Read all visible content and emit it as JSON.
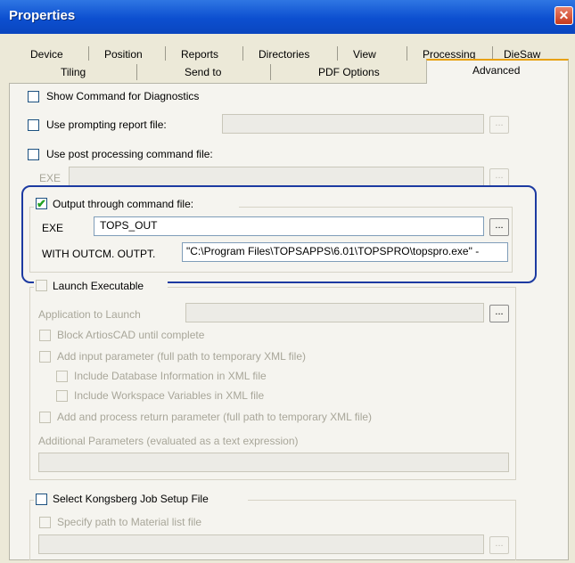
{
  "window": {
    "title": "Properties",
    "close_symbol": "✕"
  },
  "tabs": {
    "row1": [
      "Device",
      "Position",
      "Reports",
      "Directories",
      "View",
      "Processing",
      "DieSaw"
    ],
    "row2": [
      "Tiling",
      "Send to",
      "PDF Options",
      "Advanced"
    ],
    "active": "Advanced"
  },
  "options": {
    "show_command": {
      "label": "Show Command for Diagnostics",
      "checked": false
    },
    "prompting_report": {
      "label": "Use prompting report file:",
      "checked": false,
      "value": "",
      "browse": "..."
    },
    "post_processing": {
      "label": "Use post processing command file:",
      "checked": false,
      "exe_label": "EXE",
      "exe_value": "",
      "browse": "..."
    }
  },
  "output_command": {
    "label": "Output through command file:",
    "checked": true,
    "exe_label": "EXE",
    "exe_value": "TOPS_OUT",
    "browse": "...",
    "with_label": "WITH OUTCM. OUTPT.",
    "with_value": "\"C:\\Program Files\\TOPSAPPS\\6.01\\TOPSPRO\\topspro.exe\" -"
  },
  "launch_executable": {
    "label": "Launch Executable",
    "app_label": "Application to Launch",
    "app_value": "",
    "browse": "...",
    "block_label": "Block ArtiosCAD until complete",
    "add_input_label": "Add input parameter (full path to temporary XML file)",
    "include_db_label": "Include Database Information in XML file",
    "include_ws_label": "Include Workspace Variables in XML file",
    "add_return_label": "Add and process return parameter (full path to temporary XML file)",
    "additional_label": "Additional Parameters (evaluated as a text expression)",
    "additional_value": ""
  },
  "kongsberg": {
    "label": "Select Kongsberg Job Setup File",
    "material_label": "Specify path to Material list file",
    "material_value": "",
    "browse": "..."
  },
  "colors": {
    "titlebar": "#0c4fd0",
    "highlight_outline": "#1c3aa1",
    "dialog_bg": "#ece9d8"
  },
  "icons": {
    "checkmark": "✔"
  }
}
